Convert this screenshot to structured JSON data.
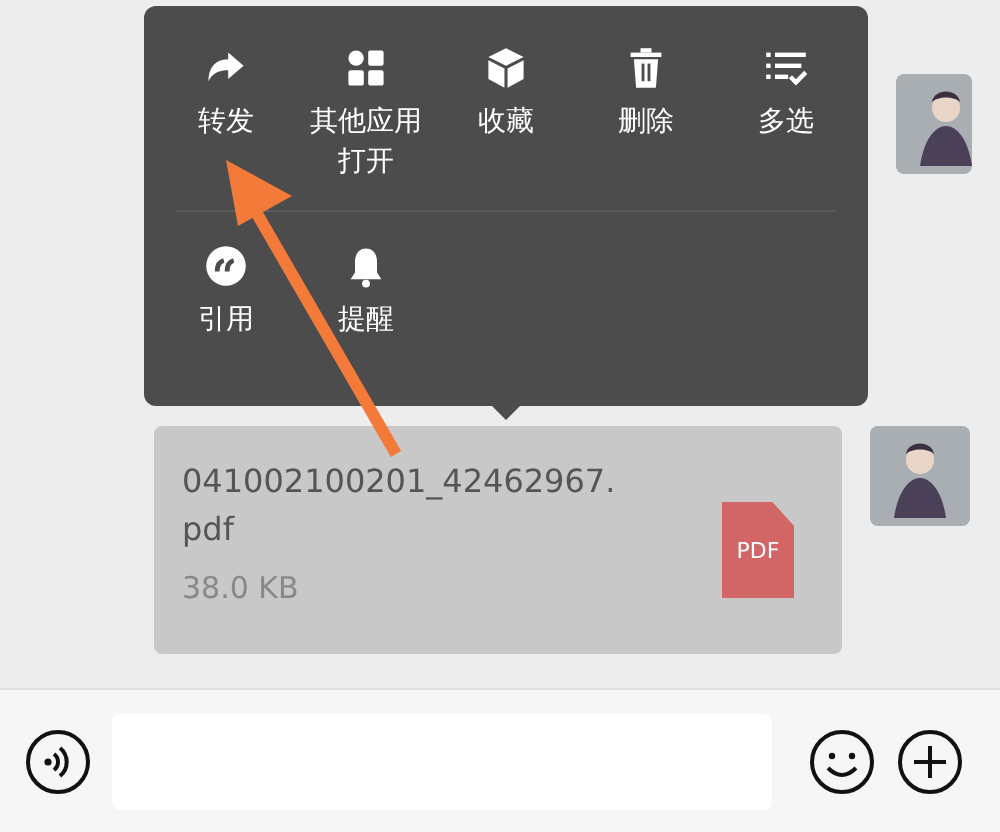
{
  "menu": {
    "rows": [
      {
        "items": [
          {
            "kind": "forward",
            "label": "转发"
          },
          {
            "kind": "apps",
            "label": "其他应用打开"
          },
          {
            "kind": "favorite",
            "label": "收藏"
          },
          {
            "kind": "delete",
            "label": "删除"
          },
          {
            "kind": "multiselect",
            "label": "多选"
          }
        ]
      },
      {
        "items": [
          {
            "kind": "quote",
            "label": "引用"
          },
          {
            "kind": "remind",
            "label": "提醒"
          }
        ]
      }
    ]
  },
  "file_message": {
    "name": "041002100201_42462967.pdf",
    "size": "38.0 KB",
    "type_badge": "PDF"
  }
}
